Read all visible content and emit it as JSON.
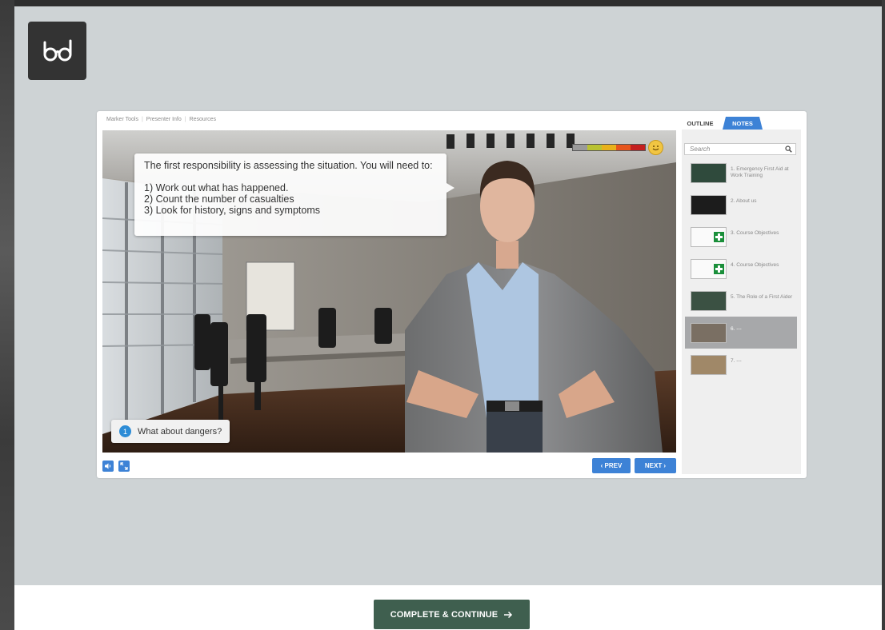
{
  "player": {
    "top_links": [
      "Marker Tools",
      "Presenter Info",
      "Resources"
    ],
    "callout": {
      "line1": "The first responsibility is assessing the situation. You will need to:",
      "item1": "1) Work out what has happened.",
      "item2": "2) Count the number of casualties",
      "item3": "3) Look for history, signs and symptoms"
    },
    "question": {
      "number": "1",
      "text": "What about dangers?"
    },
    "prev_label": "‹ PREV",
    "next_label": "NEXT ›",
    "meter_colors": [
      "#9a9a9a",
      "#b9c231",
      "#e8b11a",
      "#e6551c",
      "#c41f1f"
    ],
    "icons": {
      "volume": "volume-icon",
      "expand": "expand-icon",
      "smiley": "smiley-icon",
      "search": "search-icon",
      "glasses": "glasses-icon",
      "arrow": "arrow-right-icon"
    }
  },
  "sidebar": {
    "tab_outline": "OUTLINE",
    "tab_notes": "NOTES",
    "search_placeholder": "Search",
    "items": [
      {
        "label": "1. Emergency First Aid at Work Training"
      },
      {
        "label": "2. About us"
      },
      {
        "label": "3. Course Objectives"
      },
      {
        "label": "4. Course Objectives"
      },
      {
        "label": "5. The Role of a First Aider"
      },
      {
        "label": "6. ---"
      },
      {
        "label": "7. ---"
      }
    ],
    "selected_index": 5
  },
  "footer": {
    "complete_label": "COMPLETE & CONTINUE"
  },
  "colors": {
    "accent": "#3d82d6",
    "complete": "#3f5f4f",
    "stage": "#ced3d5"
  }
}
